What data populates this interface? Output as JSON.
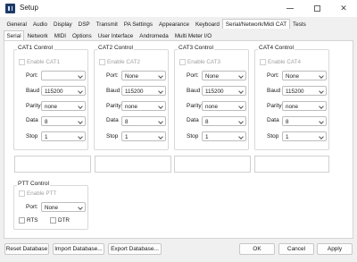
{
  "window": {
    "title": "Setup"
  },
  "tabs_row1": [
    "General",
    "Audio",
    "Display",
    "DSP",
    "Transmit",
    "PA Settings",
    "Appearance",
    "Keyboard",
    "Serial/Network/Midi CAT",
    "Tests"
  ],
  "tabs_row2": [
    "Serial",
    "Network",
    "MIDI",
    "Options",
    "User Interface",
    "Andromeda",
    "Multi Meter I/O"
  ],
  "active_tab_row1": "Serial/Network/Midi CAT",
  "active_tab_row2": "Serial",
  "field_labels": {
    "port": "Port:",
    "baud": "Baud",
    "parity": "Parity",
    "data": "Data",
    "stop": "Stop"
  },
  "cat_controls": [
    {
      "title": "CAT1 Control",
      "enable_label": "Enable CAT1",
      "port": "",
      "baud": "115200",
      "parity": "none",
      "data": "8",
      "stop": "1"
    },
    {
      "title": "CAT2 Control",
      "enable_label": "Enable CAT2",
      "port": "None",
      "baud": "115200",
      "parity": "none",
      "data": "8",
      "stop": "1"
    },
    {
      "title": "CAT3 Control",
      "enable_label": "Enable CAT3",
      "port": "None",
      "baud": "115200",
      "parity": "none",
      "data": "8",
      "stop": "1"
    },
    {
      "title": "CAT4 Control",
      "enable_label": "Enable CAT4",
      "port": "None",
      "baud": "115200",
      "parity": "none",
      "data": "8",
      "stop": "1"
    }
  ],
  "ptt": {
    "title": "PTT Control",
    "enable_label": "Enable PTT",
    "port_label": "Port:",
    "port": "None",
    "rts_label": "RTS",
    "dtr_label": "DTR"
  },
  "buttons": {
    "reset_db": "Reset Database",
    "import_db": "Import Database...",
    "export_db": "Export Database...",
    "ok": "OK",
    "cancel": "Cancel",
    "apply": "Apply"
  }
}
